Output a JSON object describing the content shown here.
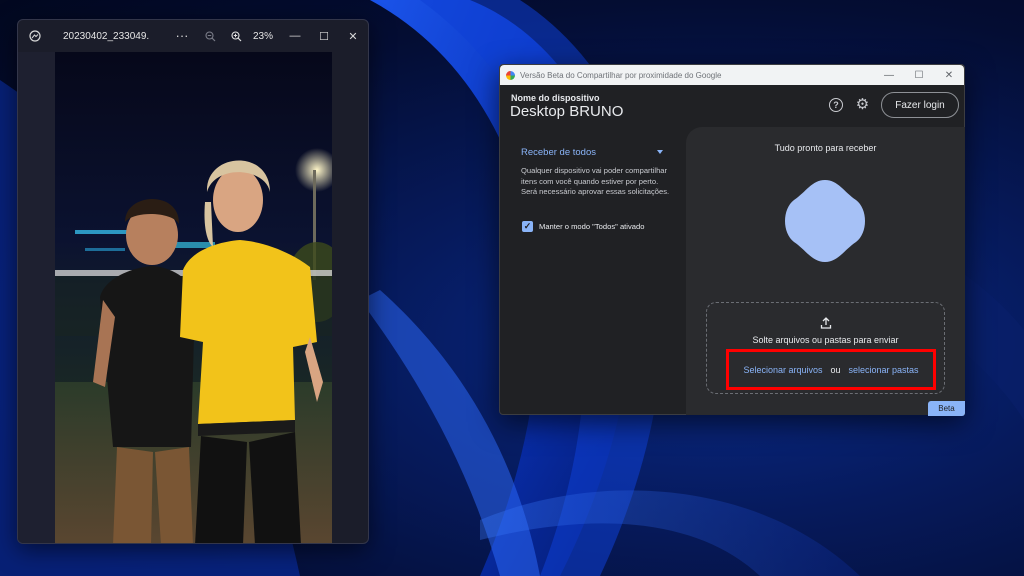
{
  "photos_app": {
    "filename": "20230402_233049.j...",
    "more_icon": "more-horizontal-icon",
    "zoom_out_icon": "zoom-out-icon",
    "zoom_in_icon": "zoom-in-icon",
    "zoom_level": "23%"
  },
  "nearby_share": {
    "window_title": "Versão Beta do Compartilhar por proximidade do Google",
    "device_label": "Nome do dispositivo",
    "device_name": "Desktop BRUNO",
    "login_button": "Fazer login",
    "receive_option": "Receber de todos",
    "receive_description": "Qualquer dispositivo vai poder compartilhar itens com você quando estiver por perto. Será necessário aprovar essas solicitações.",
    "keep_mode_label": "Manter o modo \"Todos\" ativado",
    "keep_mode_checked": true,
    "ready_text": "Tudo pronto para receber",
    "drop_text": "Solte arquivos ou pastas para enviar",
    "select_files": "Selecionar arquivos",
    "or_text": "ou",
    "select_folders": "selecionar pastas",
    "beta_badge": "Beta",
    "accent_color": "#8ab4f8",
    "highlight_color": "#ff0000"
  }
}
